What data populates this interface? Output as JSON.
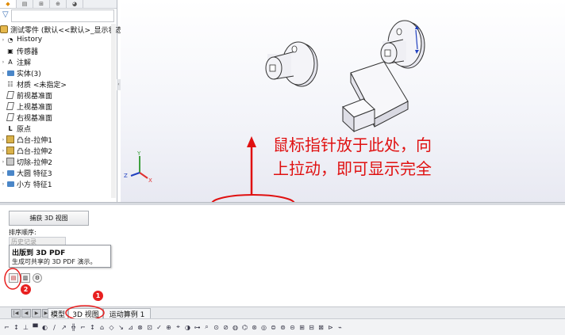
{
  "left_panel": {
    "tree": [
      {
        "label": "测试零件 (默认<<默认>_显示状态",
        "icon": "part-icon",
        "arrow": ""
      },
      {
        "label": "History",
        "icon": "history-icon",
        "arrow": "›"
      },
      {
        "label": "传感器",
        "icon": "sensor-icon",
        "arrow": ""
      },
      {
        "label": "注解",
        "icon": "annotation-icon",
        "arrow": "›"
      },
      {
        "label": "实体(3)",
        "icon": "solid-bodies-icon",
        "arrow": "›"
      },
      {
        "label": "材质 <未指定>",
        "icon": "material-icon",
        "arrow": ""
      },
      {
        "label": "前视基准面",
        "icon": "plane-icon",
        "arrow": ""
      },
      {
        "label": "上视基准面",
        "icon": "plane-icon",
        "arrow": ""
      },
      {
        "label": "右视基准面",
        "icon": "plane-icon",
        "arrow": ""
      },
      {
        "label": "原点",
        "icon": "origin-icon",
        "arrow": ""
      },
      {
        "label": "凸台-拉伸1",
        "icon": "boss-extrude-icon",
        "arrow": "›"
      },
      {
        "label": "凸台-拉伸2",
        "icon": "boss-extrude-icon",
        "arrow": "›"
      },
      {
        "label": "切除-拉伸2",
        "icon": "cut-extrude-icon",
        "arrow": "›"
      },
      {
        "label": "大圆 特征3",
        "icon": "folder-icon",
        "arrow": "›"
      },
      {
        "label": "小方 特征1",
        "icon": "folder-icon",
        "arrow": "›"
      }
    ]
  },
  "viewport": {
    "annotation": "鼠标指针放于此处，向上拉动，即可显示完全",
    "annotation_line1": "鼠标指针放于此处，向",
    "annotation_line2": "上拉动，即可显示完全",
    "axis_labels": {
      "x": "X",
      "y": "Y",
      "z": "Z"
    },
    "accent_color": "#e01010"
  },
  "bottom_panel": {
    "capture_button": "捕获 3D 视图",
    "sort_label": "排序顺序:",
    "sort_value": "历史记录",
    "tooltip_title": "出版到 3D PDF",
    "tooltip_desc": "生成可共享的 3D PDF 演示。",
    "badge1": "1",
    "badge2": "2"
  },
  "tabs": [
    {
      "label": "模型"
    },
    {
      "label": "3D 视图"
    },
    {
      "label": "运动算例 1"
    }
  ]
}
